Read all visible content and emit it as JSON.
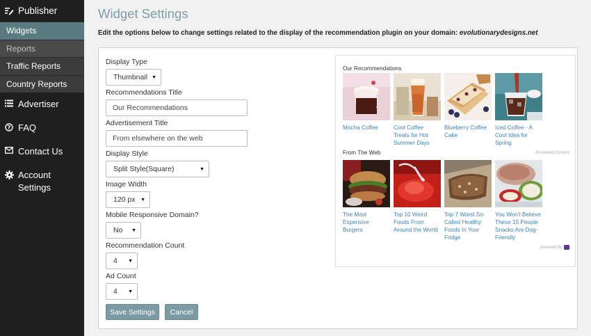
{
  "sidebar": {
    "publisher": "Publisher",
    "sub_items": [
      "Widgets",
      "Reports",
      "Traffic Reports",
      "Country Reports"
    ],
    "advertiser": "Advertiser",
    "faq": "FAQ",
    "contact": "Contact Us",
    "account_line1": "Account",
    "account_line2": "Settings"
  },
  "main": {
    "title": "Widget Settings",
    "description": "Edit the options below to change settings related to the display of the recommendation plugin on your domain:",
    "domain": "evolutionarydesigns.net"
  },
  "form": {
    "display_type_label": "Display Type",
    "display_type_value": "Thumbnail",
    "rec_title_label": "Recommendations Title",
    "rec_title_value": "Our Recommendations",
    "ad_title_label": "Advertisement Title",
    "ad_title_value": "From elsewhere on the web",
    "display_style_label": "Display Style",
    "display_style_value": "Split Style(Square)",
    "image_width_label": "Image Width",
    "image_width_value": "120 px",
    "mobile_label": "Mobile Responsive Domain?",
    "mobile_value": "No",
    "rec_count_label": "Recommendation Count",
    "rec_count_value": "4",
    "ad_count_label": "Ad Count",
    "ad_count_value": "4",
    "save_label": "Save Settings",
    "cancel_label": "Cancel"
  },
  "preview": {
    "rec_heading": "Our Recommendations",
    "recs": [
      {
        "caption": "Mocha Coffee"
      },
      {
        "caption": "Cool Coffee Treats for Hot Summer Days"
      },
      {
        "caption": "Blueberry Coffee Cake"
      },
      {
        "caption": "Iced Coffee - A Cool Idea for Spring"
      }
    ],
    "promoted": "Promoted Content",
    "ads_heading": "From The Web",
    "ads": [
      {
        "caption": "The Most Expensive Burgers"
      },
      {
        "caption": "Top 10 Weird Foods From Around the World"
      },
      {
        "caption": "Top 7 Worst So-Called Healthy Foods In Your Fridge"
      },
      {
        "caption": "You Won't Believe These 15 People Snacks Are Dog-Friendly"
      }
    ],
    "powered": "powered by"
  },
  "colors": {
    "accent": "#7a9ba1",
    "title": "#7f9ea6",
    "sidebar_bg": "#1f1f1f",
    "sidebar_active": "#5a7b80",
    "link": "#3a83b8"
  },
  "icons": {
    "publisher": "edit-icon",
    "advertiser": "list-icon",
    "faq": "help-icon",
    "contact": "envelope-icon",
    "account": "gear-icon"
  }
}
